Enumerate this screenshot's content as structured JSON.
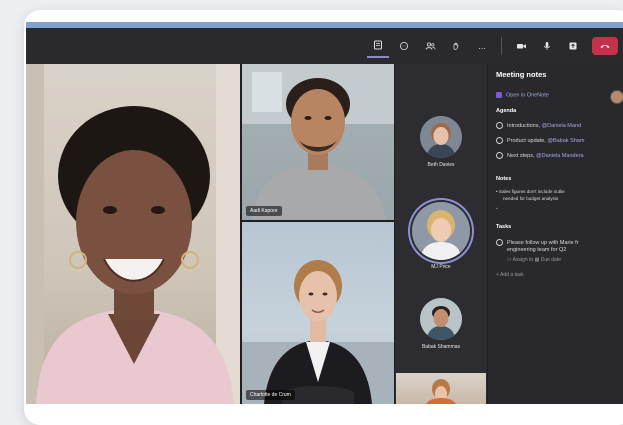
{
  "toolbar": {
    "buttons": [
      "notes-icon",
      "chat-icon",
      "people-icon",
      "reactions-icon",
      "more-icon",
      "camera-icon",
      "mic-icon",
      "share-icon",
      "hangup-icon"
    ],
    "more_label": "..."
  },
  "participants": {
    "main_speaker": "",
    "aadi": "Aadi Kapoor",
    "charlotte": "Charlotte de Crum",
    "strip": [
      {
        "name": "Beth Davies"
      },
      {
        "name": "MJ Price"
      },
      {
        "name": "Babak Shammas"
      }
    ]
  },
  "notes": {
    "title": "Meeting notes",
    "open_link": "Open in OneNote",
    "agenda_heading": "Agenda",
    "agenda": [
      {
        "text": "Introductions, ",
        "mention": "@Daniela Mand"
      },
      {
        "text": "Product update, ",
        "mention": "@Babak Sham"
      },
      {
        "text": "Next steps, ",
        "mention": "@Daniela Mandera"
      }
    ],
    "notes_heading": "Notes",
    "notes_bullet_1": "Sales figures don't include outlie",
    "notes_bullet_2": "needed for budget analysis",
    "tasks_heading": "Tasks",
    "task_1_line1": "Please follow up with Marie fr",
    "task_1_line2": "engineering team for Q2",
    "task_assign": "Assign to",
    "task_due": "Due date",
    "add_task": "Add a task"
  },
  "colors": {
    "accent": "#8b8cc7",
    "hangup": "#c4314b",
    "panel": "#29292d",
    "topstrip": "#7fa3cc"
  }
}
